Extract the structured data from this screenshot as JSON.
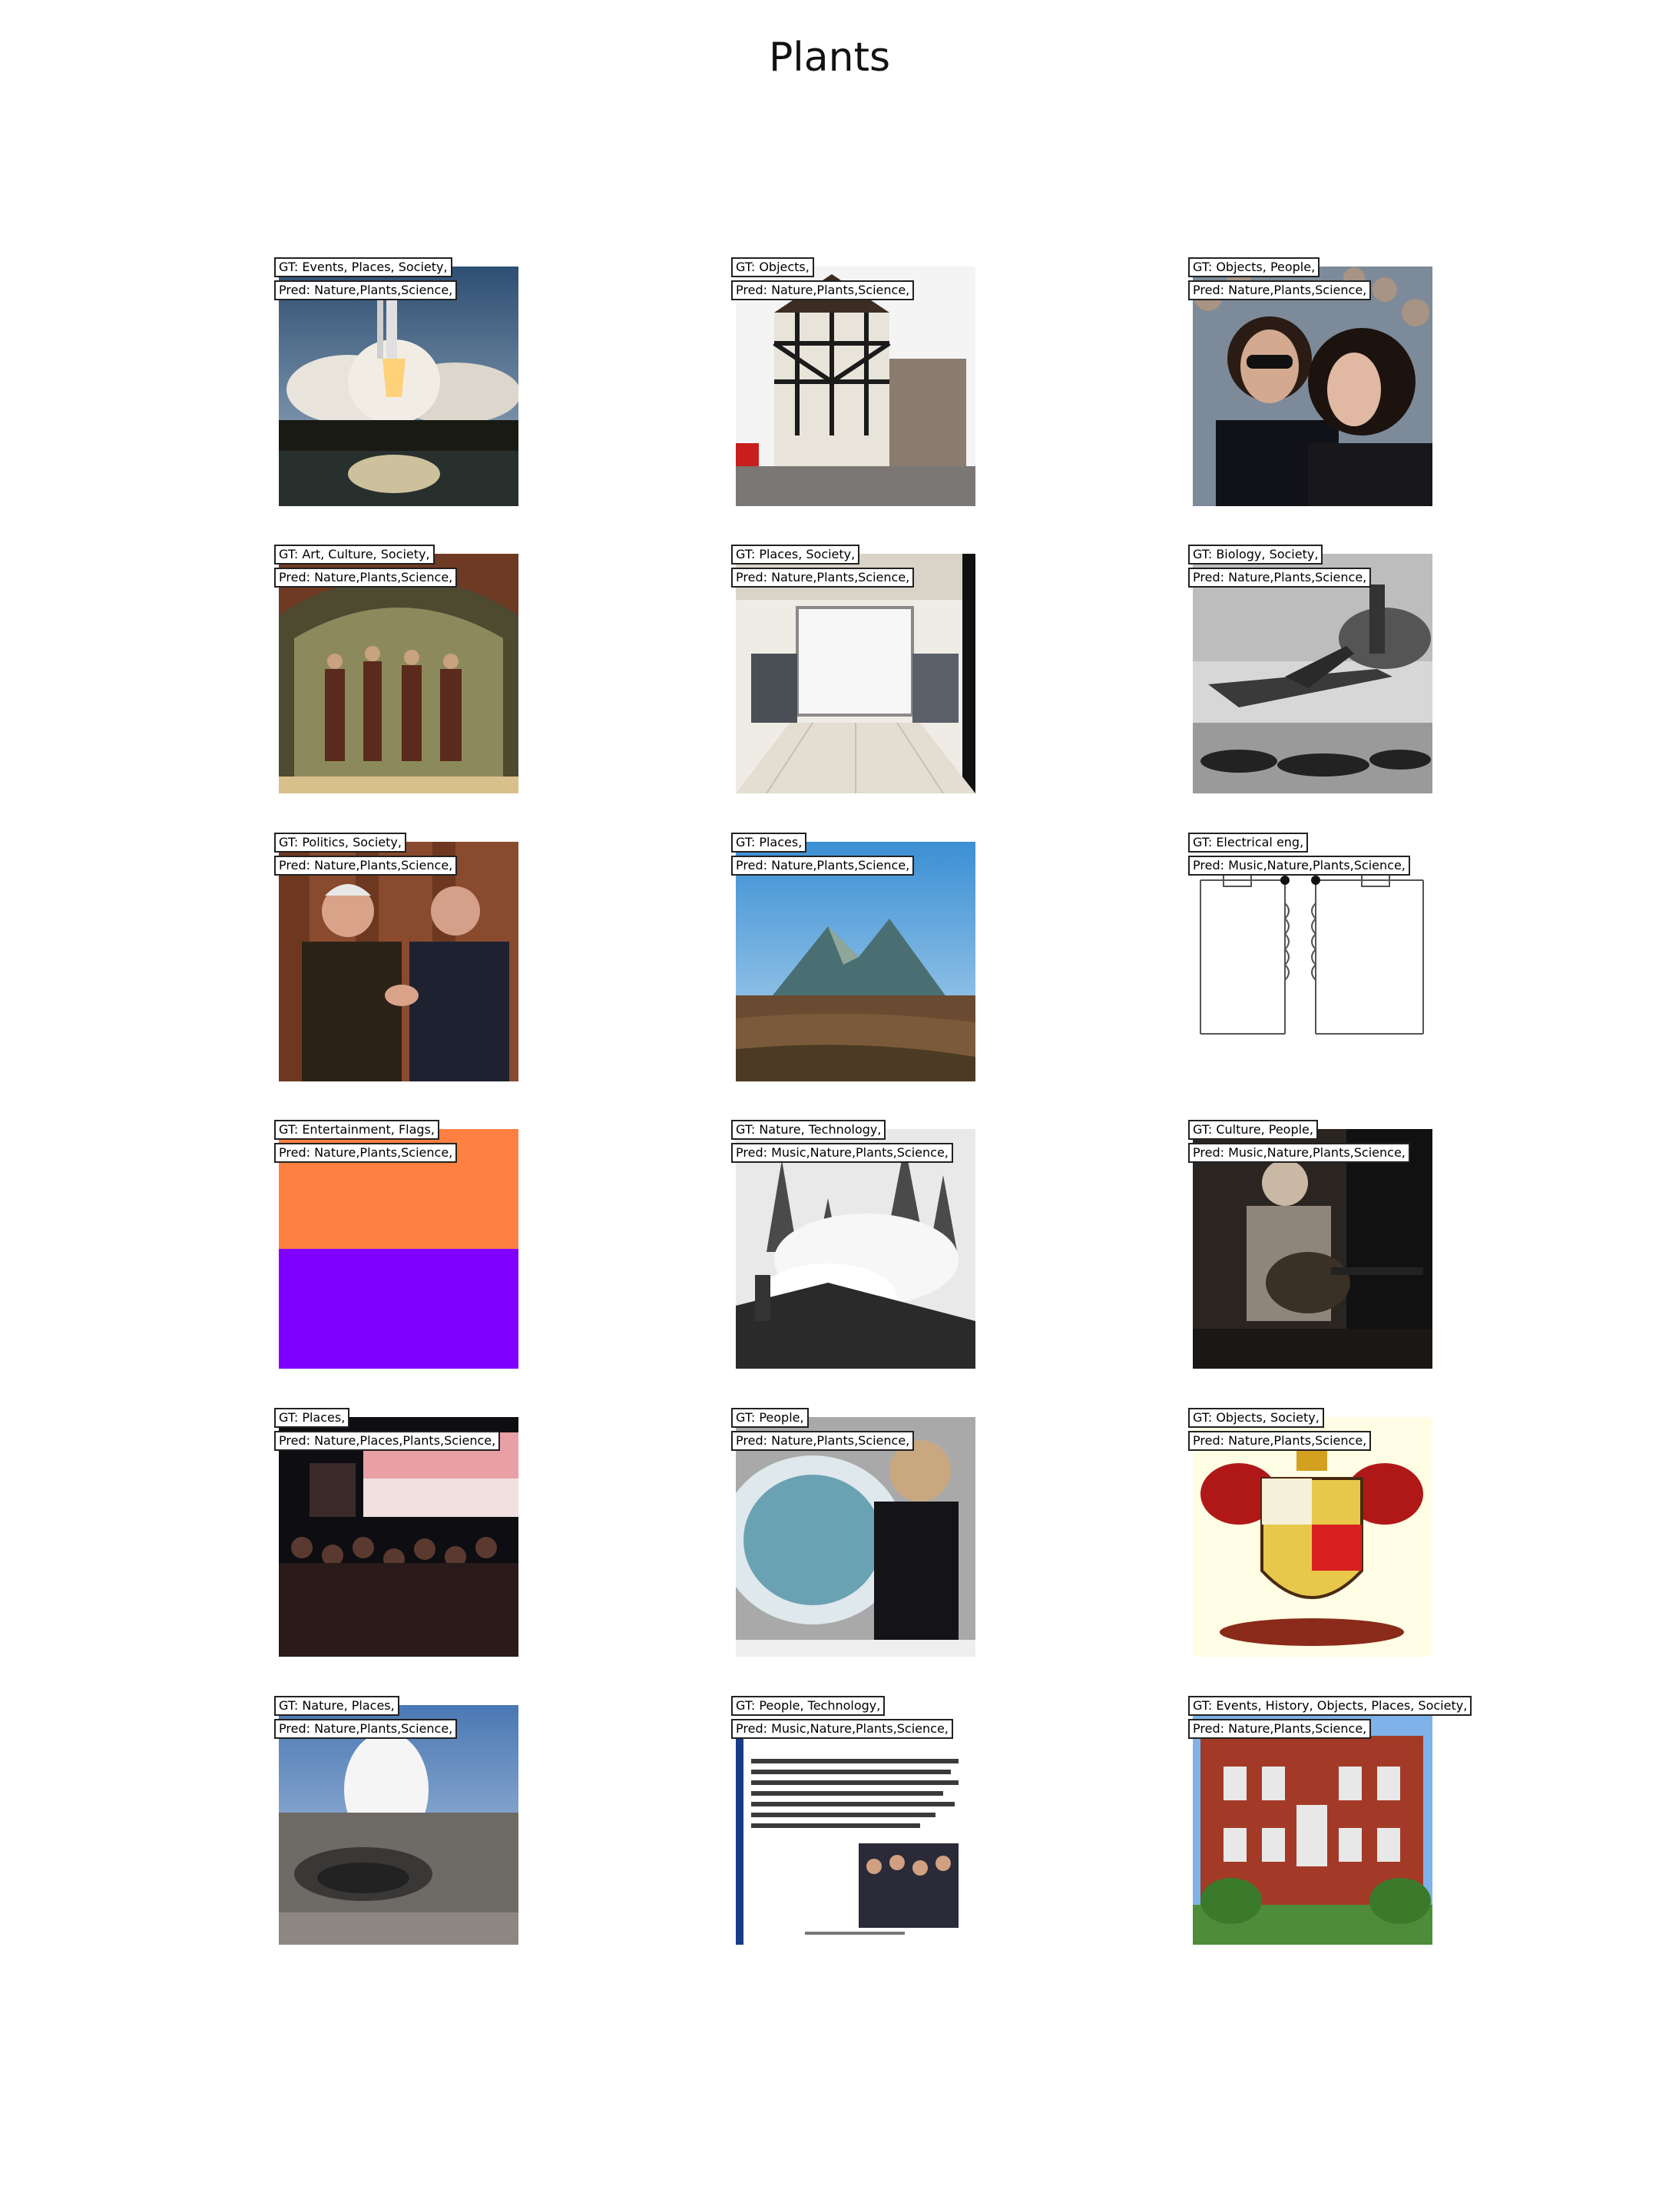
{
  "title": "Plants",
  "cells": [
    {
      "gt": "GT: Events, Places, Society,",
      "pred": "Pred: Nature,Plants,Science,",
      "scene": "shuttle-launch"
    },
    {
      "gt": "GT: Objects,",
      "pred": "Pred: Nature,Plants,Science,",
      "scene": "tudor-street"
    },
    {
      "gt": "GT: Objects, People,",
      "pred": "Pred: Nature,Plants,Science,",
      "scene": "couple-crowd"
    },
    {
      "gt": "GT: Art, Culture, Society,",
      "pred": "Pred: Nature,Plants,Science,",
      "scene": "fresco-painting"
    },
    {
      "gt": "GT: Places, Society,",
      "pred": "Pred: Nature,Plants,Science,",
      "scene": "shop-interior"
    },
    {
      "gt": "GT: Biology, Society,",
      "pred": "Pred: Nature,Plants,Science,",
      "scene": "jet-carrier"
    },
    {
      "gt": "GT: Politics, Society,",
      "pred": "Pred: Nature,Plants,Science,",
      "scene": "handshake"
    },
    {
      "gt": "GT: Places,",
      "pred": "Pred: Nature,Plants,Science,",
      "scene": "mountain"
    },
    {
      "gt": "GT: Electrical eng,",
      "pred": "Pred: Music,Nature,Plants,Science,",
      "scene": "circuit"
    },
    {
      "gt": "GT: Entertainment, Flags,",
      "pred": "Pred: Nature,Plants,Science,",
      "scene": "flag"
    },
    {
      "gt": "GT: Nature, Technology,",
      "pred": "Pred: Music,Nature,Plants,Science,",
      "scene": "forest-smoke"
    },
    {
      "gt": "GT: Culture, People,",
      "pred": "Pred: Music,Nature,Plants,Science,",
      "scene": "guitarist"
    },
    {
      "gt": "GT: Places,",
      "pred": "Pred: Nature,Places,Plants,Science,",
      "scene": "crowd-night"
    },
    {
      "gt": "GT: People,",
      "pred": "Pred: Nature,Plants,Science,",
      "scene": "fashion"
    },
    {
      "gt": "GT: Objects, Society,",
      "pred": "Pred: Nature,Plants,Science,",
      "scene": "coat-of-arms"
    },
    {
      "gt": "GT: Nature, Places,",
      "pred": "Pred: Nature,Plants,Science,",
      "scene": "volcano"
    },
    {
      "gt": "GT: People, Technology,",
      "pred": "Pred: Music,Nature,Plants,Science,",
      "scene": "document-slide"
    },
    {
      "gt": "GT: Events, History, Objects, Places, Society,",
      "pred": "Pred: Nature,Plants,Science,",
      "scene": "brick-building"
    }
  ]
}
